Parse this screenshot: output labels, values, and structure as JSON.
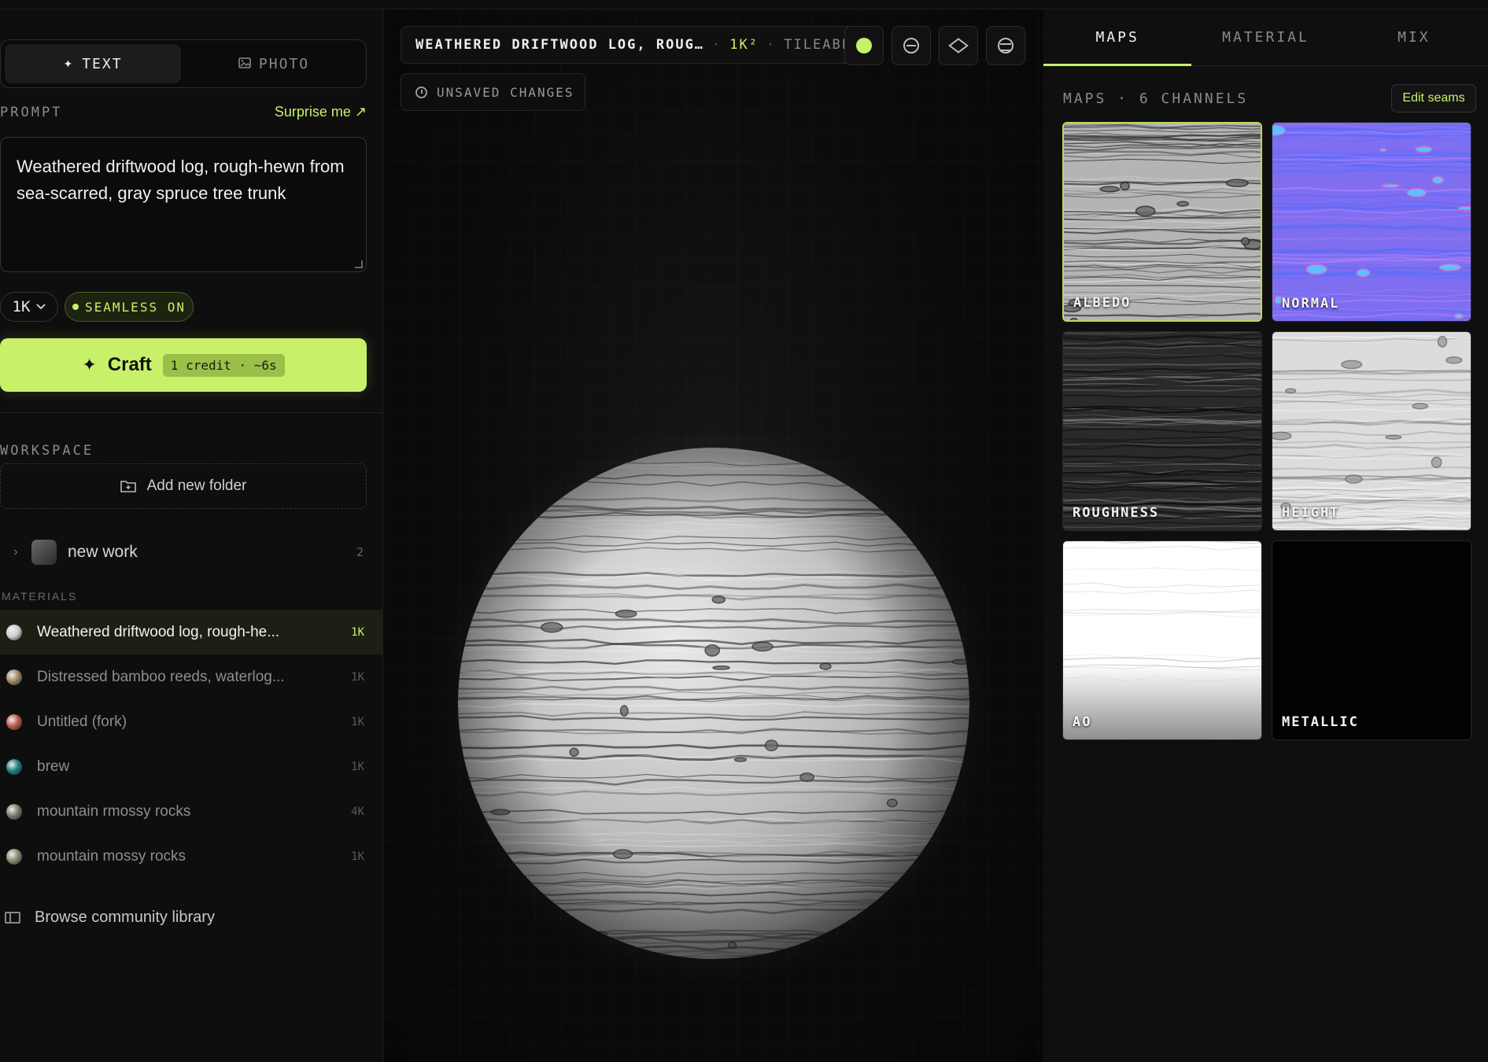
{
  "source_toggle": {
    "text_label": "TEXT",
    "text_icon": "✦",
    "photo_label": "PHOTO"
  },
  "prompt": {
    "label": "PROMPT",
    "surprise_label": "Surprise me ↗",
    "value": "Weathered driftwood log, rough-hewn from sea-scarred, gray spruce tree trunk"
  },
  "controls": {
    "resolution": "1K",
    "seamless_label": "SEAMLESS ON"
  },
  "craft": {
    "label": "Craft",
    "credit": "1 credit · ~6s"
  },
  "workspace": {
    "label": "WORKSPACE",
    "add_folder_label": "Add new folder",
    "folder": {
      "name": "new work",
      "count": "2"
    },
    "materials_label": "MATERIALS",
    "materials": [
      {
        "name": "Weathered driftwood log, rough-he...",
        "res": "1K",
        "color": "#cfcfcf",
        "active": true
      },
      {
        "name": "Distressed bamboo reeds, waterlog...",
        "res": "1K",
        "color": "#a08a62",
        "active": false
      },
      {
        "name": "Untitled (fork)",
        "res": "1K",
        "color": "#b85a4c",
        "active": false
      },
      {
        "name": "brew",
        "res": "1K",
        "color": "#1f7f7c",
        "active": false
      },
      {
        "name": "mountain rmossy rocks",
        "res": "4K",
        "color": "#7a7a6a",
        "active": false
      },
      {
        "name": "mountain mossy rocks",
        "res": "1K",
        "color": "#8a8a70",
        "active": false
      }
    ],
    "browse_label": "Browse community library"
  },
  "viewport": {
    "title": "WEATHERED DRIFTWOOD LOG, ROUG…",
    "res": "1K²",
    "tileable": "TILEABLE",
    "status": "UNSAVED CHANGES"
  },
  "panel": {
    "tabs": [
      "MAPS",
      "MATERIAL",
      "MIX"
    ],
    "maps_header": "MAPS · 6 CHANNELS",
    "edit_seams_label": "Edit seams",
    "maps": [
      "ALBEDO",
      "NORMAL",
      "ROUGHNESS",
      "HEIGHT",
      "AO",
      "METALLIC"
    ]
  },
  "colors": {
    "accent": "#c8f169",
    "background": "#0a0a0a"
  }
}
